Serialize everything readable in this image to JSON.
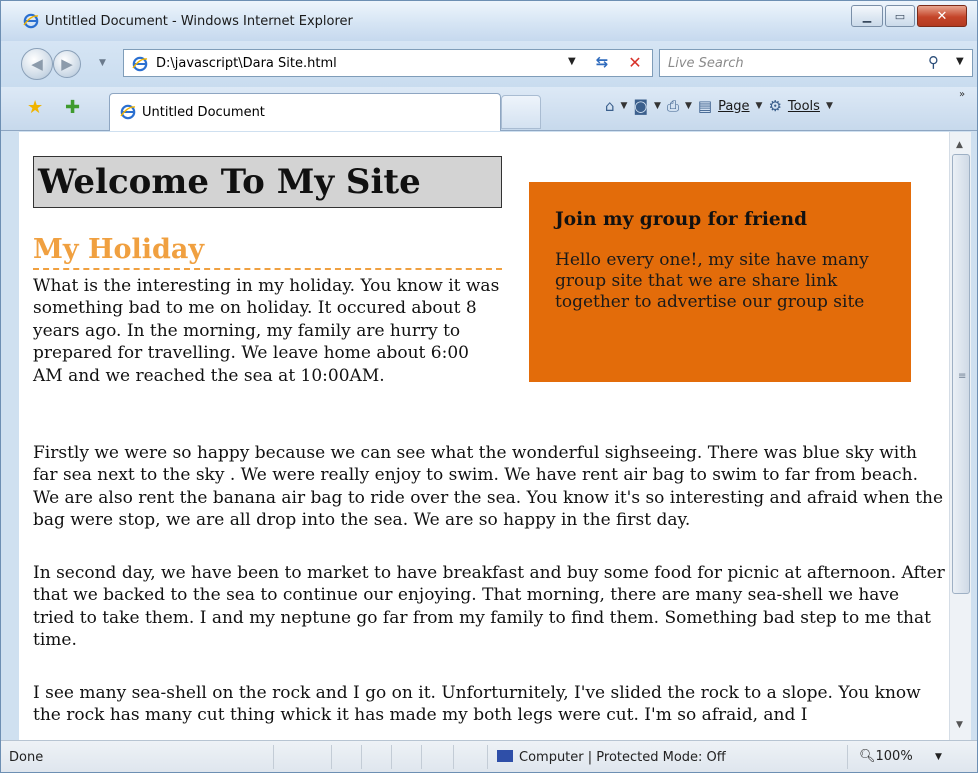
{
  "window": {
    "title": "Untitled Document - Windows Internet Explorer"
  },
  "address": {
    "url": "D:\\javascript\\Dara Site.html",
    "search_placeholder": "Live Search"
  },
  "tab": {
    "label": "Untitled Document"
  },
  "toolbar": {
    "page_label": "Page",
    "tools_label": "Tools"
  },
  "page": {
    "title": "Welcome To My Site",
    "subtitle": "My Holiday",
    "paragraph1": "What is the interesting in my holiday. You know it was something bad to me on holiday. It occured about 8 years ago. In the morning, my family are hurry to prepared for travelling. We leave home about 6:00 AM and we reached the sea at 10:00AM.",
    "paragraph2": "Firstly we were so happy because we can see what the wonderful sighseeing. There was blue sky with far sea next to the sky . We were really enjoy to swim. We have rent air bag to swim to far from beach. We are also rent the banana air bag to ride over the sea. You know it's so interesting and afraid when the bag were stop, we are all drop into the sea. We are so happy in the first day.",
    "paragraph3": "In second day, we have been to market to have breakfast and buy some food for picnic at afternoon. After that we backed to the sea to continue our enjoying. That morning, there are many sea-shell we have tried to take them. I and my neptune go far from my family to find them. Something bad step to me that time.",
    "paragraph4": "I see many sea-shell on the rock and I go on it. Unforturnitely, I've slided the rock to a slope. You know the rock has many cut thing whick it has made my both legs were cut. I'm so afraid, and I",
    "sidebox_title": "Join my group for friend",
    "sidebox_text": "Hello every one!, my site have many group site that we are share link together to advertise our group site"
  },
  "status": {
    "text": "Done",
    "zone": "Computer | Protected Mode: Off",
    "zoom": "100%"
  },
  "colors": {
    "sidebox": "#e36c0a",
    "subtitle": "#f0a040",
    "heading_bg": "#d3d3d3"
  }
}
